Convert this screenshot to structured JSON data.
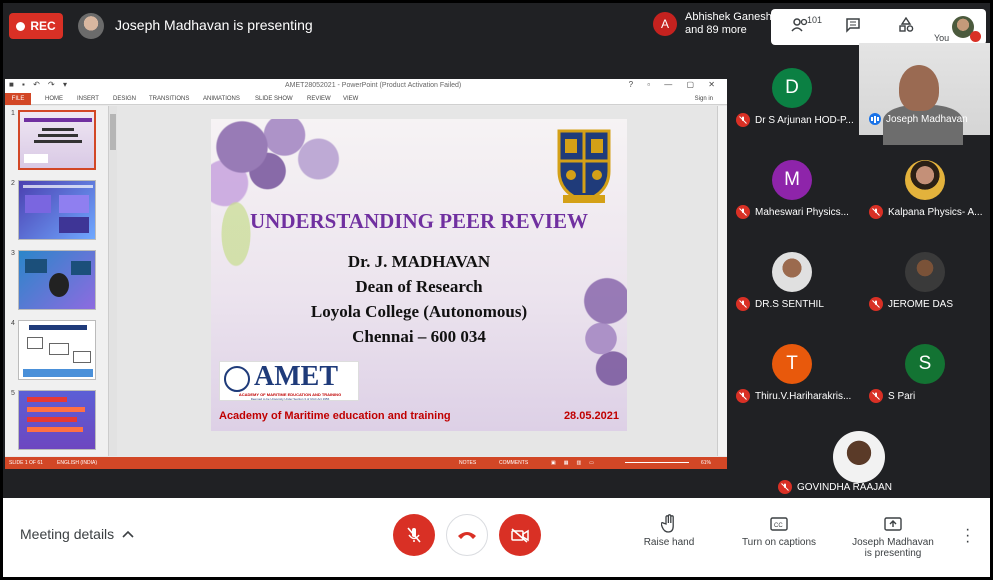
{
  "top": {
    "rec_label": "REC",
    "presenting_text": "Joseph Madhavan is presenting",
    "pinned": {
      "initial": "A",
      "line1": "Abhishek Ganesh",
      "line2": "and 89 more"
    },
    "participants_count": "101",
    "you_label": "You"
  },
  "ppt": {
    "window_title": "AMET28052021 - PowerPoint (Product Activation Failed)",
    "file_tab": "FILE",
    "tabs": [
      "HOME",
      "INSERT",
      "DESIGN",
      "TRANSITIONS",
      "ANIMATIONS",
      "SLIDE SHOW",
      "REVIEW",
      "VIEW"
    ],
    "sign_in": "Sign in",
    "thumb_numbers": [
      "1",
      "2",
      "3",
      "4",
      "5"
    ],
    "status_slide": "SLIDE 1 OF 61",
    "status_lang": "ENGLISH (INDIA)",
    "status_notes": "NOTES",
    "status_comments": "COMMENTS",
    "status_zoom": "61%"
  },
  "slide": {
    "title": "UNDERSTANDING PEER REVIEW",
    "lines": [
      "Dr. J. MADHAVAN",
      "Dean of Research",
      "Loyola College (Autonomous)",
      "Chennai – 600 034"
    ],
    "logo_text": "AMET",
    "logo_sub": "ACADEMY OF MARITIME EDUCATION AND TRAINING",
    "logo_sub2": "Deemed to be University Under Section 3 of UGC Act 1956",
    "footer_left": "Academy of Maritime education and training",
    "footer_date": "28.05.2021"
  },
  "participants": [
    {
      "name": "Dr S Arjunan HOD-P...",
      "initial": "D",
      "color": "#0b8043"
    },
    {
      "name": "Joseph Madhavan"
    },
    {
      "name": "Maheswari Physics...",
      "initial": "M",
      "color": "#8e24aa"
    },
    {
      "name": "Kalpana Physics- A..."
    },
    {
      "name": "DR.S SENTHIL"
    },
    {
      "name": "JEROME DAS"
    },
    {
      "name": "Thiru.V.Hariharakris...",
      "initial": "T",
      "color": "#e8590c"
    },
    {
      "name": "S Pari",
      "initial": "S",
      "color": "#137333"
    },
    {
      "name": "GOVINDHA RAAJAN"
    }
  ],
  "bottom": {
    "meeting_details": "Meeting details",
    "raise_hand": "Raise hand",
    "captions": "Turn on captions",
    "presenting_line1": "Joseph Madhavan",
    "presenting_line2": "is presenting"
  },
  "colors": {
    "meet_bg": "#202124",
    "rec_red": "#d93025",
    "ppt_orange": "#d24726",
    "slide_title_purple": "#7030a0"
  }
}
